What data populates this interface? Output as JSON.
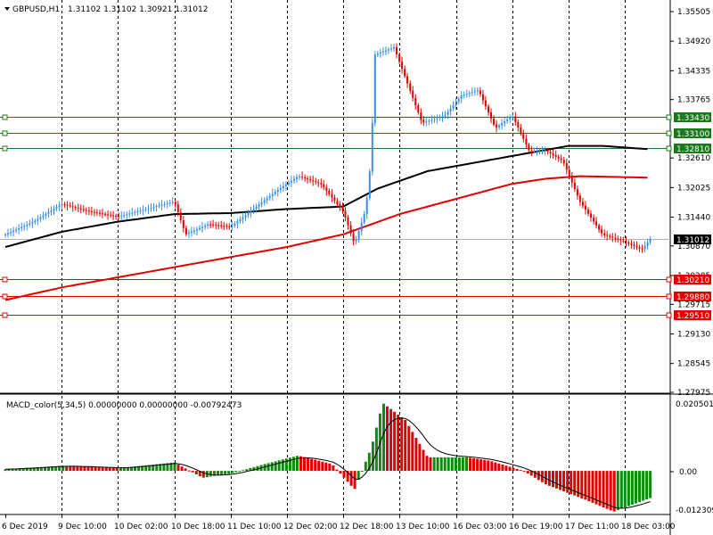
{
  "header": {
    "symbol_label": "GBPUSD,H1",
    "ohlc": "1.31102 1.31102 1.30921 1.31012"
  },
  "macd": {
    "label": "MACD_color(5,34,5) 0.00000000 0.00000000 -0.00792473",
    "ticks": [
      "0.0205013",
      "0.00",
      "-0.0123090"
    ]
  },
  "price_axis": {
    "ticks": [
      "1.35505",
      "1.34920",
      "1.34335",
      "1.33765",
      "1.32610",
      "1.32025",
      "1.31440",
      "1.30870",
      "1.30285",
      "1.29715",
      "1.29130",
      "1.28545",
      "1.27975"
    ],
    "current_price": "1.31012"
  },
  "levels": [
    {
      "price": "1.33430",
      "color": "#1a7a1a"
    },
    {
      "price": "1.33100",
      "color": "#1a7a1a"
    },
    {
      "price": "1.32810",
      "color": "#1a7a1a"
    },
    {
      "price": "1.30210",
      "color": "#e00000"
    },
    {
      "price": "1.29880",
      "color": "#e00000"
    },
    {
      "price": "1.29510",
      "color": "#e00000"
    }
  ],
  "time_axis": [
    "6 Dec 2019",
    "9 Dec 10:00",
    "10 Dec 02:00",
    "10 Dec 18:00",
    "11 Dec 10:00",
    "12 Dec 02:00",
    "12 Dec 18:00",
    "13 Dec 10:00",
    "16 Dec 03:00",
    "16 Dec 19:00",
    "17 Dec 11:00",
    "18 Dec 03:00"
  ],
  "colors": {
    "bull": "#3b8fe0",
    "bear": "#e00000",
    "ma_fast": "#000000",
    "ma_slow": "#e00000",
    "hist_up": "#128a12",
    "hist_down": "#e00000"
  },
  "chart_data": {
    "type": "candlestick",
    "symbol": "GBPUSD",
    "timeframe": "H1",
    "y_range": [
      1.27975,
      1.35505
    ],
    "x_categories": [
      "6 Dec 2019",
      "9 Dec 10:00",
      "10 Dec 02:00",
      "10 Dec 18:00",
      "11 Dec 10:00",
      "12 Dec 02:00",
      "12 Dec 18:00",
      "13 Dec 10:00",
      "16 Dec 03:00",
      "16 Dec 19:00",
      "17 Dec 11:00",
      "18 Dec 03:00"
    ],
    "close_path": [
      [
        0,
        1.311
      ],
      [
        0.5,
        1.3135
      ],
      [
        1,
        1.317
      ],
      [
        1.5,
        1.3155
      ],
      [
        2,
        1.3145
      ],
      [
        2.5,
        1.316
      ],
      [
        3,
        1.3175
      ],
      [
        3.2,
        1.311
      ],
      [
        3.6,
        1.313
      ],
      [
        4,
        1.3125
      ],
      [
        4.4,
        1.316
      ],
      [
        4.8,
        1.3195
      ],
      [
        5.2,
        1.3225
      ],
      [
        5.6,
        1.321
      ],
      [
        6,
        1.3155
      ],
      [
        6.2,
        1.309
      ],
      [
        6.4,
        1.316
      ],
      [
        6.5,
        1.327
      ],
      [
        6.55,
        1.3465
      ],
      [
        6.9,
        1.348
      ],
      [
        7.1,
        1.342
      ],
      [
        7.4,
        1.333
      ],
      [
        7.8,
        1.3345
      ],
      [
        8.1,
        1.3385
      ],
      [
        8.4,
        1.3395
      ],
      [
        8.7,
        1.332
      ],
      [
        9,
        1.3345
      ],
      [
        9.3,
        1.3275
      ],
      [
        9.6,
        1.3275
      ],
      [
        9.9,
        1.3255
      ],
      [
        10.2,
        1.3175
      ],
      [
        10.6,
        1.311
      ],
      [
        11,
        1.3095
      ],
      [
        11.3,
        1.308
      ],
      [
        11.45,
        1.3101
      ]
    ],
    "ma_fast_path": [
      [
        0,
        1.3085
      ],
      [
        1,
        1.3115
      ],
      [
        2,
        1.3135
      ],
      [
        3,
        1.315
      ],
      [
        4,
        1.3152
      ],
      [
        5,
        1.316
      ],
      [
        6,
        1.3165
      ],
      [
        6.6,
        1.32
      ],
      [
        7.5,
        1.3235
      ],
      [
        8.5,
        1.3255
      ],
      [
        9.5,
        1.3275
      ],
      [
        10,
        1.3285
      ],
      [
        10.6,
        1.3285
      ],
      [
        11.45,
        1.3278
      ]
    ],
    "ma_slow_path": [
      [
        0,
        1.298
      ],
      [
        1,
        1.3005
      ],
      [
        2,
        1.3025
      ],
      [
        3,
        1.3045
      ],
      [
        4,
        1.3065
      ],
      [
        5,
        1.3085
      ],
      [
        6,
        1.311
      ],
      [
        7,
        1.315
      ],
      [
        8,
        1.318
      ],
      [
        9,
        1.321
      ],
      [
        9.6,
        1.322
      ],
      [
        10.2,
        1.3225
      ],
      [
        11.45,
        1.3222
      ]
    ],
    "macd_range": [
      -0.012309,
      0.0205013
    ],
    "macd_hist_path": [
      [
        0,
        0.0005
      ],
      [
        1,
        0.0015
      ],
      [
        2,
        0.0008
      ],
      [
        3,
        0.0025
      ],
      [
        3.5,
        -0.002
      ],
      [
        4,
        -0.0008
      ],
      [
        4.6,
        0.002
      ],
      [
        5.2,
        0.0045
      ],
      [
        5.8,
        0.002
      ],
      [
        6.2,
        -0.0055
      ],
      [
        6.5,
        0.007
      ],
      [
        6.7,
        0.02
      ],
      [
        7.1,
        0.015
      ],
      [
        7.5,
        0.004
      ],
      [
        8.2,
        0.004
      ],
      [
        8.6,
        0.003
      ],
      [
        9.2,
        0.0
      ],
      [
        9.6,
        -0.004
      ],
      [
        10.3,
        -0.0085
      ],
      [
        10.8,
        -0.012
      ],
      [
        11.45,
        -0.008
      ]
    ]
  }
}
